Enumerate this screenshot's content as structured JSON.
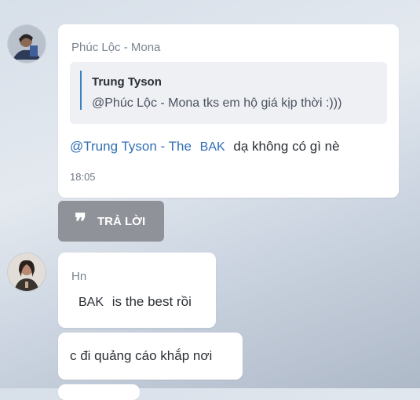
{
  "thread": {
    "messages": [
      {
        "sender": "Phúc Lộc - Mona",
        "quote": {
          "author": "Trung Tyson",
          "text": "@Phúc Lộc - Mona tks em hộ giá kịp thời :)))"
        },
        "mention": "@Trung Tyson - The",
        "mention_tag": "BAK",
        "text": "dạ không có gì nè",
        "time": "18:05"
      },
      {
        "sender": "Hn",
        "tag": "BAK",
        "text": "is the best rồi"
      },
      {
        "text": "c đi quảng cáo khắp nơi"
      }
    ],
    "reply_button": {
      "icon": "❞",
      "label": "TRẢ LỜI"
    }
  }
}
